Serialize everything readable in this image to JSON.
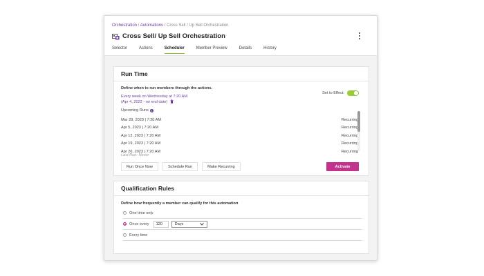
{
  "breadcrumb": {
    "item1": "Orchestration",
    "sep1": " / ",
    "item2": "Automations",
    "sep2": " / ",
    "item3": "Cross Sell / Up Sell Orchestration"
  },
  "header": {
    "title": "Cross Sell/ Up Sell Orchestration"
  },
  "tabs": [
    {
      "label": "Selector"
    },
    {
      "label": "Actions"
    },
    {
      "label": "Scheduler",
      "active": true
    },
    {
      "label": "Member Preview"
    },
    {
      "label": "Details"
    },
    {
      "label": "History"
    }
  ],
  "run_time": {
    "title": "Run Time",
    "description": "Define when to run members through the actions.",
    "set_to_effect_label": "Set to Effect:",
    "set_to_effect_on": true,
    "schedule_line1": "Every week on Wednesday at 7:20 AM.",
    "schedule_line2": "(Apr 4, 2022 - no end date)",
    "upcoming_label": "Upcoming Runs",
    "upcoming_runs": [
      {
        "date": "Mar 29, 2023 | 7:20 AM",
        "type": "Recurring"
      },
      {
        "date": "Apr 5, 2023 | 7:20 AM",
        "type": "Recurring"
      },
      {
        "date": "Apr 12, 2023 | 7:20 AM",
        "type": "Recurring"
      },
      {
        "date": "Apr 19, 2023 | 7:20 AM",
        "type": "Recurring"
      },
      {
        "date": "Apr 26, 2023 | 7:20 AM",
        "type": "Recurring"
      }
    ],
    "last_run": "Last Run: Never",
    "buttons": {
      "run_once": "Run Once Now",
      "schedule_run": "Schedule Run",
      "make_recurring": "Make Recurring",
      "activate": "Activate"
    }
  },
  "qualification": {
    "title": "Qualification Rules",
    "description": "Define how frequently a member can qualify for this automation",
    "options": [
      {
        "label": "One time only",
        "selected": false
      },
      {
        "label": "Once every",
        "selected": true
      },
      {
        "label": "Every time",
        "selected": false
      }
    ],
    "interval_value": "120",
    "interval_unit": "Days"
  },
  "colors": {
    "accent_purple": "#6b3fa0",
    "activate_magenta": "#c2338d",
    "toggle_green": "#9ac93a",
    "tab_underline": "#8fbf2a"
  },
  "icons": [
    "orchestration-icon",
    "kebab-menu-icon",
    "trash-icon",
    "info-icon",
    "chevron-down-icon"
  ]
}
